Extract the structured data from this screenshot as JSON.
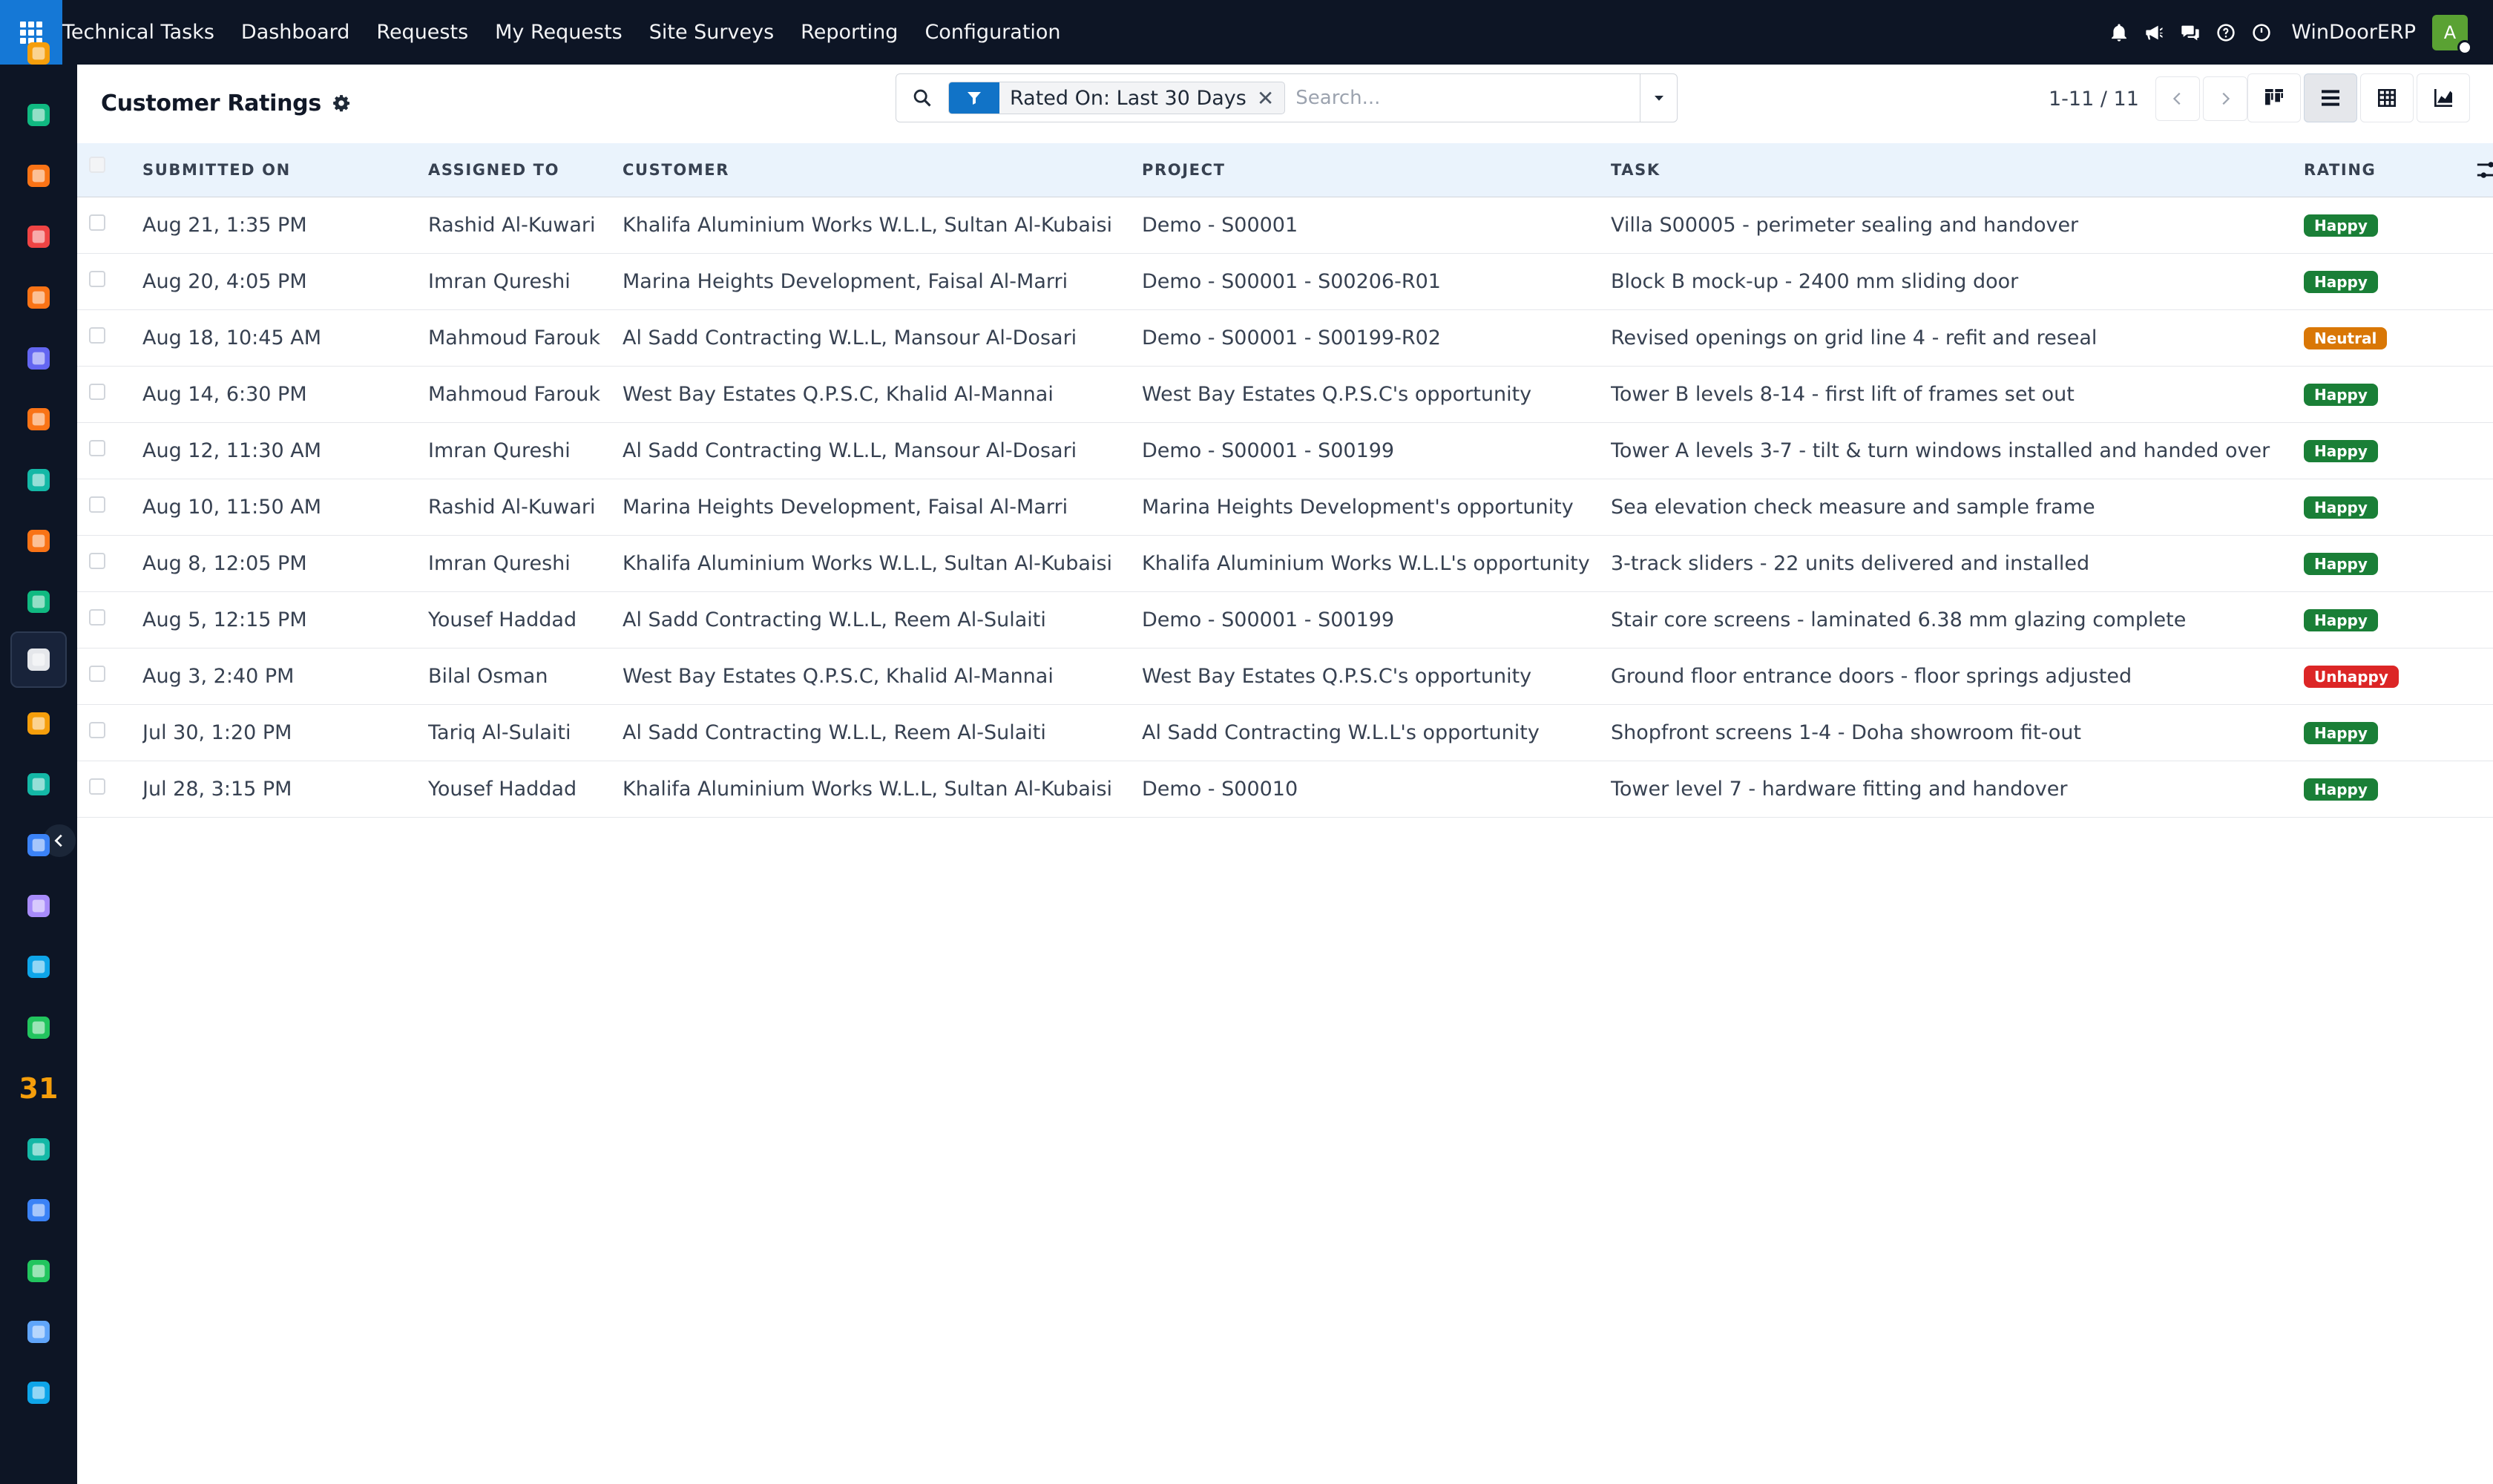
{
  "topbar": {
    "brand": "Technical Tasks",
    "menu": [
      "Dashboard",
      "Requests",
      "My Requests",
      "Site Surveys",
      "Reporting",
      "Configuration"
    ],
    "company": "WinDoorERP",
    "avatar_letter": "A"
  },
  "control": {
    "title": "Customer Ratings",
    "filter_facet": "Rated On: Last 30 Days",
    "search_placeholder": "Search...",
    "pager": "1-11 / 11"
  },
  "table": {
    "columns": [
      "SUBMITTED ON",
      "ASSIGNED TO",
      "CUSTOMER",
      "PROJECT",
      "TASK",
      "RATING"
    ],
    "rows": [
      {
        "submitted": "Aug 21, 1:35 PM",
        "assigned": "Rashid Al-Kuwari",
        "customer": "Khalifa Aluminium Works W.L.L, Sultan Al-Kubaisi",
        "project": "Demo - S00001",
        "task": "Villa S00005 - perimeter sealing and handover",
        "rating": "Happy",
        "rating_color": "#1a7f37"
      },
      {
        "submitted": "Aug 20, 4:05 PM",
        "assigned": "Imran Qureshi",
        "customer": "Marina Heights Development, Faisal Al-Marri",
        "project": "Demo - S00001 - S00206-R01",
        "task": "Block B mock-up - 2400 mm sliding door",
        "rating": "Happy",
        "rating_color": "#1a7f37"
      },
      {
        "submitted": "Aug 18, 10:45 AM",
        "assigned": "Mahmoud Farouk",
        "customer": "Al Sadd Contracting W.L.L, Mansour Al-Dosari",
        "project": "Demo - S00001 - S00199-R02",
        "task": "Revised openings on grid line 4 - refit and reseal",
        "rating": "Neutral",
        "rating_color": "#d97706"
      },
      {
        "submitted": "Aug 14, 6:30 PM",
        "assigned": "Mahmoud Farouk",
        "customer": "West Bay Estates Q.P.S.C, Khalid Al-Mannai",
        "project": "West Bay Estates Q.P.S.C's opportunity",
        "task": "Tower B levels 8-14 - first lift of frames set out",
        "rating": "Happy",
        "rating_color": "#1a7f37"
      },
      {
        "submitted": "Aug 12, 11:30 AM",
        "assigned": "Imran Qureshi",
        "customer": "Al Sadd Contracting W.L.L, Mansour Al-Dosari",
        "project": "Demo - S00001 - S00199",
        "task": "Tower A levels 3-7 - tilt & turn windows installed and handed over",
        "rating": "Happy",
        "rating_color": "#1a7f37"
      },
      {
        "submitted": "Aug 10, 11:50 AM",
        "assigned": "Rashid Al-Kuwari",
        "customer": "Marina Heights Development, Faisal Al-Marri",
        "project": "Marina Heights Development's opportunity",
        "task": "Sea elevation check measure and sample frame",
        "rating": "Happy",
        "rating_color": "#1a7f37"
      },
      {
        "submitted": "Aug 8, 12:05 PM",
        "assigned": "Imran Qureshi",
        "customer": "Khalifa Aluminium Works W.L.L, Sultan Al-Kubaisi",
        "project": "Khalifa Aluminium Works W.L.L's opportunity",
        "task": "3-track sliders - 22 units delivered and installed",
        "rating": "Happy",
        "rating_color": "#1a7f37"
      },
      {
        "submitted": "Aug 5, 12:15 PM",
        "assigned": "Yousef Haddad",
        "customer": "Al Sadd Contracting W.L.L, Reem Al-Sulaiti",
        "project": "Demo - S00001 - S00199",
        "task": "Stair core screens - laminated 6.38 mm glazing complete",
        "rating": "Happy",
        "rating_color": "#1a7f37"
      },
      {
        "submitted": "Aug 3, 2:40 PM",
        "assigned": "Bilal Osman",
        "customer": "West Bay Estates Q.P.S.C, Khalid Al-Mannai",
        "project": "West Bay Estates Q.P.S.C's opportunity",
        "task": "Ground floor entrance doors - floor springs adjusted",
        "rating": "Unhappy",
        "rating_color": "#dc2626"
      },
      {
        "submitted": "Jul 30, 1:20 PM",
        "assigned": "Tariq Al-Sulaiti",
        "customer": "Al Sadd Contracting W.L.L, Reem Al-Sulaiti",
        "project": "Al Sadd Contracting W.L.L's opportunity",
        "task": "Shopfront screens 1-4 - Doha showroom fit-out",
        "rating": "Happy",
        "rating_color": "#1a7f37"
      },
      {
        "submitted": "Jul 28, 3:15 PM",
        "assigned": "Yousef Haddad",
        "customer": "Khalifa Aluminium Works W.L.L, Sultan Al-Kubaisi",
        "project": "Demo - S00010",
        "task": "Tower level 7 - hardware fitting and handover",
        "rating": "Happy",
        "rating_color": "#1a7f37"
      }
    ]
  },
  "sidebar": {
    "apps": [
      {
        "name": "app-discuss",
        "color": "#f59e0b"
      },
      {
        "name": "app-contacts",
        "color": "#10b981"
      },
      {
        "name": "app-reporting",
        "color": "#f97316"
      },
      {
        "name": "app-planning",
        "color": "#ef4444"
      },
      {
        "name": "app-helpdesk",
        "color": "#f97316"
      },
      {
        "name": "app-mail",
        "color": "#6366f1"
      },
      {
        "name": "app-chat",
        "color": "#f97316"
      },
      {
        "name": "app-delivery",
        "color": "#14b8a6"
      },
      {
        "name": "app-analytics",
        "color": "#f97316"
      },
      {
        "name": "app-employees",
        "color": "#10b981"
      },
      {
        "name": "app-technical-tasks",
        "color": "#e5e7eb"
      },
      {
        "name": "app-notes",
        "color": "#f59e0b"
      },
      {
        "name": "app-tasks",
        "color": "#14b8a6"
      },
      {
        "name": "app-knowledge",
        "color": "#3b82f6"
      },
      {
        "name": "app-inventory",
        "color": "#a78bfa"
      },
      {
        "name": "app-documents",
        "color": "#0ea5e9"
      },
      {
        "name": "app-team",
        "color": "#22c55e"
      },
      {
        "name": "app-calendar",
        "color": "#f59e0b",
        "label": "31"
      },
      {
        "name": "app-sign",
        "color": "#14b8a6"
      },
      {
        "name": "app-dashboards",
        "color": "#3b82f6"
      },
      {
        "name": "app-whatsapp",
        "color": "#22c55e"
      },
      {
        "name": "app-timesheets",
        "color": "#60a5fa"
      },
      {
        "name": "app-studio",
        "color": "#0ea5e9"
      }
    ]
  }
}
